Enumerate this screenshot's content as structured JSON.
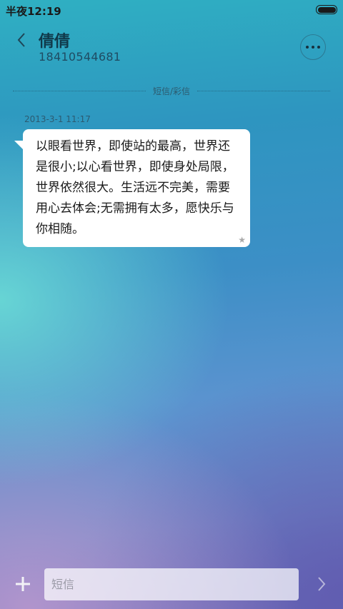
{
  "status_bar": {
    "time": "半夜12:19",
    "battery_level": 1.0
  },
  "header": {
    "contact_name": "倩倩",
    "contact_number": "18410544681",
    "back_icon": "chevron-left-icon",
    "more_icon": "more-dots-icon"
  },
  "conversation": {
    "divider_label": "短信/彩信",
    "messages": [
      {
        "timestamp": "2013-3-1 11:17",
        "text": "以眼看世界，即使站的最高，世界还是很小;以心看世界，即使身处局限，世界依然很大。生活远不完美，需要用心去体会;无需拥有太多，愿快乐与你相随。",
        "starred": true
      }
    ]
  },
  "composer": {
    "placeholder": "短信",
    "add_icon": "plus-icon",
    "send_icon": "chevron-right-icon"
  },
  "colors": {
    "bubble_background": "#ffffff",
    "accent_text": "#10394a"
  }
}
